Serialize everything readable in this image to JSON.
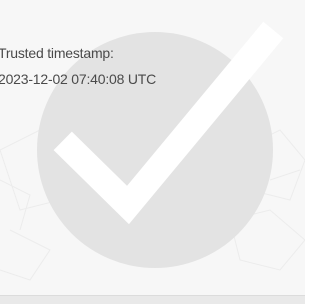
{
  "timestamp": {
    "label": "Trusted timestamp:",
    "value": "2023-12-02 07:40:08 UTC"
  },
  "icons": {
    "watermark": "checkmark-circle-icon"
  },
  "colors": {
    "background": "#f7f7f7",
    "watermark_fill": "#e3e3e3",
    "check": "#ffffff",
    "text": "#4a4a4a"
  }
}
